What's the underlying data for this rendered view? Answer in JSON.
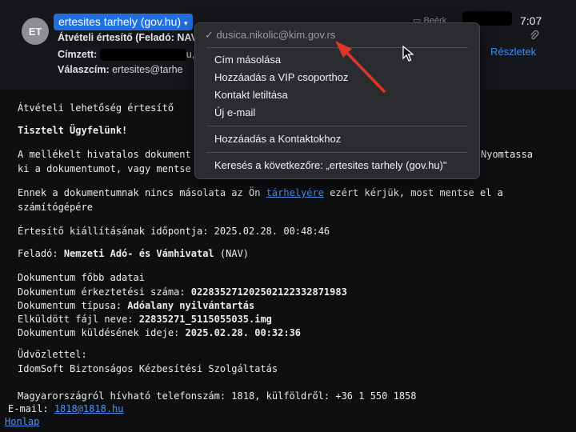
{
  "header": {
    "avatar_initials": "ET",
    "sender_name": "ertesites tarhely (gov.hu)",
    "subject_text": "Átvételi értesítő (Feladó: NAV",
    "to_label": "Címzett:",
    "to_suffix": "u,",
    "reply_label": "Válaszcím:",
    "reply_value": "ertesites@tarhe",
    "folder": "Beérk",
    "time": "7:07",
    "details_label": "Részletek"
  },
  "context_menu": {
    "selected_email": "dusica.nikolic@kim.gov.rs",
    "items": [
      "Cím másolása",
      "Hozzáadás a VIP csoporthoz",
      "Kontakt letiltása",
      "Új e-mail",
      "Hozzáadás a Kontaktokhoz",
      "Keresés a következőre: „ertesites tarhely (gov.hu)\""
    ]
  },
  "body": {
    "heading": "Átvételi lehetőség értesítő",
    "greeting": "Tisztelt Ügyfelünk!",
    "para1_start": "A mellékelt hivatalos dokument",
    "para1_end": "Nyomtassa",
    "para1_line2": "ki a dokumentumot, vagy mentse",
    "para2_pre": "Ennek a dokumentumnak nincs másolata az Ön ",
    "para2_link": "tárhelyére",
    "para2_post": " ezért kérjük, most mentse el a",
    "para2_line2": "számítógépére",
    "notice_time_label": "Értesítő kiállításának időpontja:",
    "notice_time_value": "2025.02.28. 00:48:46",
    "sender_label": "Feladó:",
    "sender_value": "Nemzeti Adó- és Vámhivatal",
    "sender_abbr": "(NAV)",
    "doc_section": "Dokumentum főbb adatai",
    "reg_label": "Dokumentum érkeztetési száma:",
    "reg_value": "02283527120250212233287198",
    "reg_last": "3",
    "type_label": "Dokumentum típusa:",
    "type_value": "Adóalany nyilvántartás",
    "file_label": "Elküldött fájl neve:",
    "file_value": "22835271_5115055035.img",
    "sent_label": "Dokumentum küldésének ideje:",
    "sent_value": "2025.02.28. 00:32:36",
    "regards": "Üdvözlettel:",
    "signature": "IdomSoft Biztonságos Kézbesítési Szolgáltatás",
    "phone_line": "Magyarországról hívható telefonszám: 1818, külföldről: +36 1 550 1858",
    "email_label": "E-mail:",
    "email_link": "1818@1818.hu",
    "homepage": "Honlap"
  },
  "icons": [
    "check-icon",
    "paperclip-icon",
    "chevron-down-icon",
    "folder-icon",
    "mouse-cursor-icon",
    "annotation-arrow-icon"
  ],
  "colors": {
    "accent": "#1f6fe0",
    "link": "#3d8ef7",
    "annotation": "#e0362a"
  }
}
